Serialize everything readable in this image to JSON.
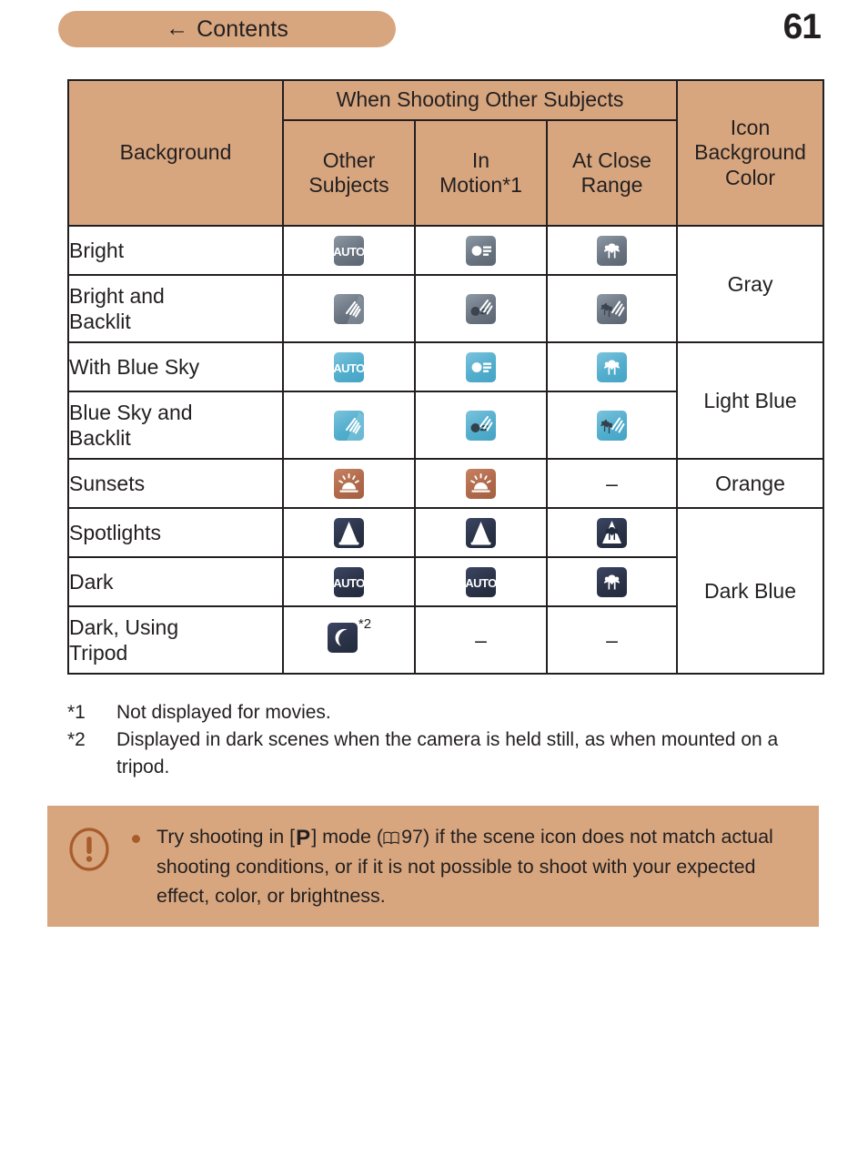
{
  "header": {
    "contents_label": "Contents",
    "back_arrow_icon": "left-arrow-icon",
    "page_number": "61"
  },
  "table": {
    "headers": {
      "background": "Background",
      "group": "When Shooting Other Subjects",
      "other_subjects": "Other\nSubjects",
      "other_subjects_line1": "Other",
      "other_subjects_line2": "Subjects",
      "in_motion_line1": "In",
      "in_motion_line2": "Motion*1",
      "at_close_range_line1": "At Close",
      "at_close_range_line2": "Range",
      "icon_bg_color_line1": "Icon",
      "icon_bg_color_line2": "Background",
      "icon_bg_color_line3": "Color"
    },
    "rows": [
      {
        "background_line1": "Bright",
        "background_line2": "",
        "other_subjects": "auto-icon",
        "in_motion": "portrait-motion-icon",
        "at_close_range": "macro-icon",
        "icon_theme": "gray"
      },
      {
        "background_line1": "Bright and",
        "background_line2": "Backlit",
        "other_subjects": "backlit-icon",
        "in_motion": "portrait-backlit-icon",
        "at_close_range": "macro-backlit-icon",
        "icon_theme": "gray"
      },
      {
        "background_line1": "With Blue Sky",
        "background_line2": "",
        "other_subjects": "auto-icon",
        "in_motion": "portrait-motion-icon",
        "at_close_range": "macro-icon",
        "icon_theme": "lightblue"
      },
      {
        "background_line1": "Blue Sky and",
        "background_line2": "Backlit",
        "other_subjects": "backlit-icon",
        "in_motion": "portrait-backlit-icon",
        "at_close_range": "macro-backlit-icon",
        "icon_theme": "lightblue"
      },
      {
        "background_line1": "Sunsets",
        "background_line2": "",
        "other_subjects": "sunset-icon",
        "in_motion": "sunset-icon",
        "at_close_range": "dash",
        "icon_theme": "orange"
      },
      {
        "background_line1": "Spotlights",
        "background_line2": "",
        "other_subjects": "spotlight-icon",
        "in_motion": "spotlight-icon",
        "at_close_range": "spotlight-macro-icon",
        "icon_theme": "darkblue"
      },
      {
        "background_line1": "Dark",
        "background_line2": "",
        "other_subjects": "auto-icon",
        "in_motion": "auto-icon",
        "at_close_range": "macro-icon",
        "icon_theme": "darkblue"
      },
      {
        "background_line1": "Dark, Using",
        "background_line2": "Tripod",
        "other_subjects": "night-moon-icon",
        "other_subjects_note": "*2",
        "in_motion": "dash",
        "at_close_range": "dash",
        "icon_theme": "darkblue"
      }
    ],
    "color_groups": [
      {
        "label": "Gray",
        "rows": 2
      },
      {
        "label": "Light Blue",
        "rows": 2
      },
      {
        "label": "Orange",
        "rows": 1
      },
      {
        "label": "Dark Blue",
        "rows": 3
      }
    ],
    "dash": "–"
  },
  "footnotes": [
    {
      "mark": "*1",
      "text": "Not displayed for movies."
    },
    {
      "mark": "*2",
      "text": "Displayed in dark scenes when the camera is held still, as when mounted on a tripod."
    }
  ],
  "caution": {
    "warning_icon": "exclamation-circle-icon",
    "bullet_icon": "bullet-dot",
    "text_part1": "Try shooting in [",
    "p_mode": "P",
    "text_part2": "] mode (",
    "book_icon": "book-reference-icon",
    "page_ref": "97",
    "text_part3": ") if the scene icon does not match actual shooting conditions, or if it is not possible to shoot with your expected effect, color, or brightness."
  },
  "colors": {
    "accent": "#d7a67f",
    "text": "#231f20",
    "warn": "#a85c2b",
    "icon_gray": "#6b7582",
    "icon_light_blue": "#52aecd",
    "icon_orange": "#b06a4b",
    "icon_dark_blue": "#2b3348"
  }
}
